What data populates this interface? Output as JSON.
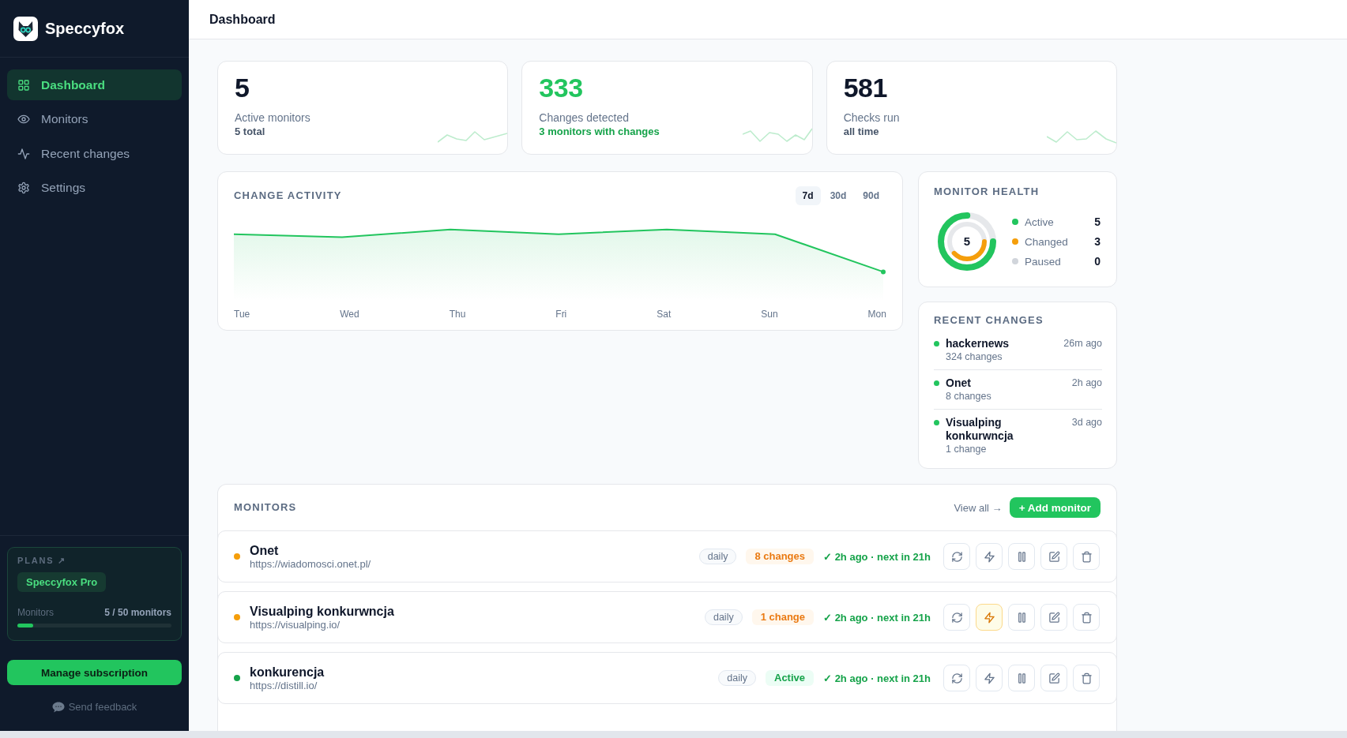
{
  "sidebar": {
    "brand": "Speccyfox",
    "nav": [
      {
        "label": "Dashboard",
        "kind": "grid",
        "selected": true
      },
      {
        "label": "Monitors",
        "kind": "eye",
        "selected": false
      },
      {
        "label": "Recent changes",
        "kind": "pulse",
        "selected": false
      },
      {
        "label": "Settings",
        "kind": "gear",
        "selected": false
      }
    ],
    "plan": {
      "heading": "PLANS ↗",
      "name": "Speccyfox Pro",
      "usage_label": "Monitors",
      "usage_value": "5 / 50 monitors",
      "level": 0.1
    },
    "manage_button": "Manage subscription",
    "feedback_link": "Send feedback"
  },
  "header": {
    "title": "Dashboard"
  },
  "stats": [
    {
      "value": "5",
      "label": "Active monitors",
      "detail": "5 total",
      "accent": false
    },
    {
      "value": "333",
      "label": "Changes detected",
      "detail": "3 monitors with changes",
      "accent": true
    },
    {
      "value": "581",
      "label": "Checks run",
      "detail": "all time",
      "accent": false
    }
  ],
  "activity": {
    "title": "CHANGE ACTIVITY",
    "ranges": [
      {
        "label": "7d",
        "selected": true
      },
      {
        "label": "30d",
        "selected": false
      },
      {
        "label": "90d",
        "selected": false
      }
    ],
    "x_labels": [
      "Tue",
      "Wed",
      "Thu",
      "Fri",
      "Sat",
      "Sun",
      "Mon"
    ]
  },
  "health": {
    "title": "MONITOR HEALTH",
    "center_value": "5",
    "legend": [
      {
        "label": "Active",
        "count": "5",
        "color": "#22c55e"
      },
      {
        "label": "Changed",
        "count": "3",
        "color": "#f59e0b"
      },
      {
        "label": "Paused",
        "count": "0",
        "color": "#d1d5db"
      }
    ]
  },
  "recent_changes": {
    "title": "RECENT CHANGES",
    "items": [
      {
        "name": "hackernews",
        "detail": "324 changes",
        "time": "26m ago"
      },
      {
        "name": "Onet",
        "detail": "8 changes",
        "time": "2h ago"
      },
      {
        "name": "Visualping konkurwncja",
        "detail": "1 change",
        "time": "3d ago"
      }
    ]
  },
  "monitors": {
    "title": "MONITORS",
    "view_all": "View all →",
    "add_button": "+ Add monitor",
    "rows": [
      {
        "name": "Onet",
        "url": "https://wiadomosci.onet.pl/",
        "color": "#f59e0b",
        "frequency": "daily",
        "status": "8 changes",
        "kind": "changed",
        "last_check": "✓ 2h ago · next in 21h",
        "bolt_highlighted": false
      },
      {
        "name": "Visualping konkurwncja",
        "url": "https://visualping.io/",
        "color": "#f59e0b",
        "frequency": "daily",
        "status": "1 change",
        "kind": "changed",
        "last_check": "✓ 2h ago · next in 21h",
        "bolt_highlighted": true
      },
      {
        "name": "konkurencja",
        "url": "https://distill.io/",
        "color": "#16a34a",
        "frequency": "daily",
        "status": "Active",
        "kind": "active",
        "last_check": "✓ 2h ago · next in 21h",
        "bolt_highlighted": false
      }
    ]
  }
}
